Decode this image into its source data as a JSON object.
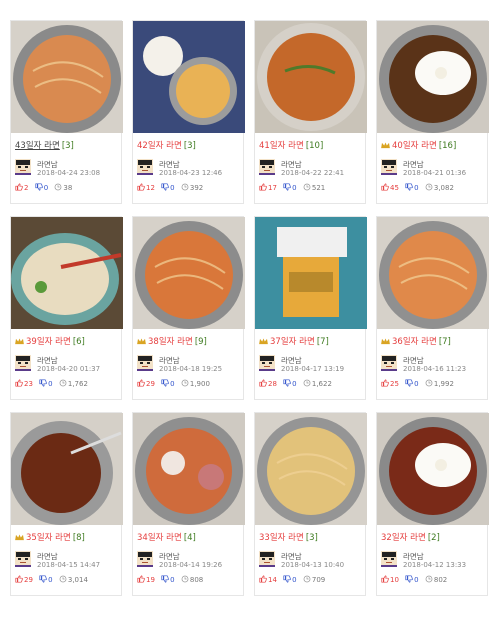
{
  "posts": [
    {
      "title": "43일자 라면",
      "comments": "[3]",
      "author": "라면남",
      "date": "2018-04-24 23:08",
      "likes": "2",
      "dislikes": "0",
      "views": "38",
      "crown": false,
      "plain": true,
      "photo": "bowl-broth-dumplings",
      "bowl_color": "#8a8a8a",
      "food_color": "#d98a50"
    },
    {
      "title": "42일자 라면",
      "comments": "[3]",
      "author": "라면남",
      "date": "2018-04-23 12:46",
      "likes": "12",
      "dislikes": "0",
      "views": "392",
      "crown": false,
      "plain": false,
      "photo": "pot-rice-tray",
      "bowl_color": "#9c9c9c",
      "food_color": "#e9b255"
    },
    {
      "title": "41일자 라면",
      "comments": "[10]",
      "author": "라면남",
      "date": "2018-04-22 22:41",
      "likes": "17",
      "dislikes": "0",
      "views": "521",
      "crown": false,
      "plain": false,
      "photo": "bowl-red-soup",
      "bowl_color": "#d5d0c8",
      "food_color": "#c4682a"
    },
    {
      "title": "40일자 라면",
      "comments": "[16]",
      "author": "라면남",
      "date": "2018-04-21 01:36",
      "likes": "45",
      "dislikes": "0",
      "views": "3,082",
      "crown": true,
      "plain": false,
      "photo": "pot-egg-black",
      "bowl_color": "#8e8e8e",
      "food_color": "#5a3318"
    },
    {
      "title": "39일자 라면",
      "comments": "[6]",
      "author": "라면남",
      "date": "2018-04-20 01:37",
      "likes": "23",
      "dislikes": "0",
      "views": "1,762",
      "crown": true,
      "plain": false,
      "photo": "bowl-pho",
      "bowl_color": "#6aa4a0",
      "food_color": "#e8dcc0"
    },
    {
      "title": "38일자 라면",
      "comments": "[9]",
      "author": "라면남",
      "date": "2018-04-18 19:25",
      "likes": "29",
      "dislikes": "0",
      "views": "1,900",
      "crown": true,
      "plain": false,
      "photo": "pot-orange-noodle",
      "bowl_color": "#8c8c8c",
      "food_color": "#d9773a"
    },
    {
      "title": "37일자 라면",
      "comments": "[7]",
      "author": "라면남",
      "date": "2018-04-17 13:19",
      "likes": "28",
      "dislikes": "0",
      "views": "1,622",
      "crown": true,
      "plain": false,
      "photo": "cup-ramen",
      "bowl_color": "#2e9d8c",
      "food_color": "#e7a93a"
    },
    {
      "title": "36일자 라면",
      "comments": "[7]",
      "author": "라면남",
      "date": "2018-04-16 11:23",
      "likes": "25",
      "dislikes": "0",
      "views": "1,992",
      "crown": true,
      "plain": false,
      "photo": "pot-orange-noodle2",
      "bowl_color": "#909090",
      "food_color": "#e0894a"
    },
    {
      "title": "35일자 라면",
      "comments": "[8]",
      "author": "라면남",
      "date": "2018-04-15 14:47",
      "likes": "29",
      "dislikes": "0",
      "views": "3,014",
      "crown": true,
      "plain": false,
      "photo": "pot-black-noodle",
      "bowl_color": "#9a9a9a",
      "food_color": "#6b2a14"
    },
    {
      "title": "34일자 라면",
      "comments": "[4]",
      "author": "라면남",
      "date": "2018-04-14 19:26",
      "likes": "19",
      "dislikes": "0",
      "views": "808",
      "crown": false,
      "plain": false,
      "photo": "pot-sausage",
      "bowl_color": "#8f8f8f",
      "food_color": "#cf6b3c"
    },
    {
      "title": "33일자 라면",
      "comments": "[3]",
      "author": "라면남",
      "date": "2018-04-13 10:40",
      "likes": "14",
      "dislikes": "0",
      "views": "709",
      "crown": false,
      "plain": false,
      "photo": "pot-yellow-noodle",
      "bowl_color": "#959595",
      "food_color": "#e2c27a"
    },
    {
      "title": "32일자 라면",
      "comments": "[2]",
      "author": "라면남",
      "date": "2018-04-12 13:33",
      "likes": "10",
      "dislikes": "0",
      "views": "802",
      "crown": false,
      "plain": false,
      "photo": "pot-egg-dark",
      "bowl_color": "#8a8a8a",
      "food_color": "#7a2a18"
    }
  ],
  "colors": {
    "title_red": "#e53d3d",
    "comment_green": "#3d7a1f",
    "crown_gold": "#d9a423"
  },
  "icons": {
    "crown": "crown-icon",
    "like": "thumbs-up-icon",
    "dislike": "thumbs-down-icon",
    "views": "eye-icon",
    "avatar": "pixel-avatar-icon"
  }
}
